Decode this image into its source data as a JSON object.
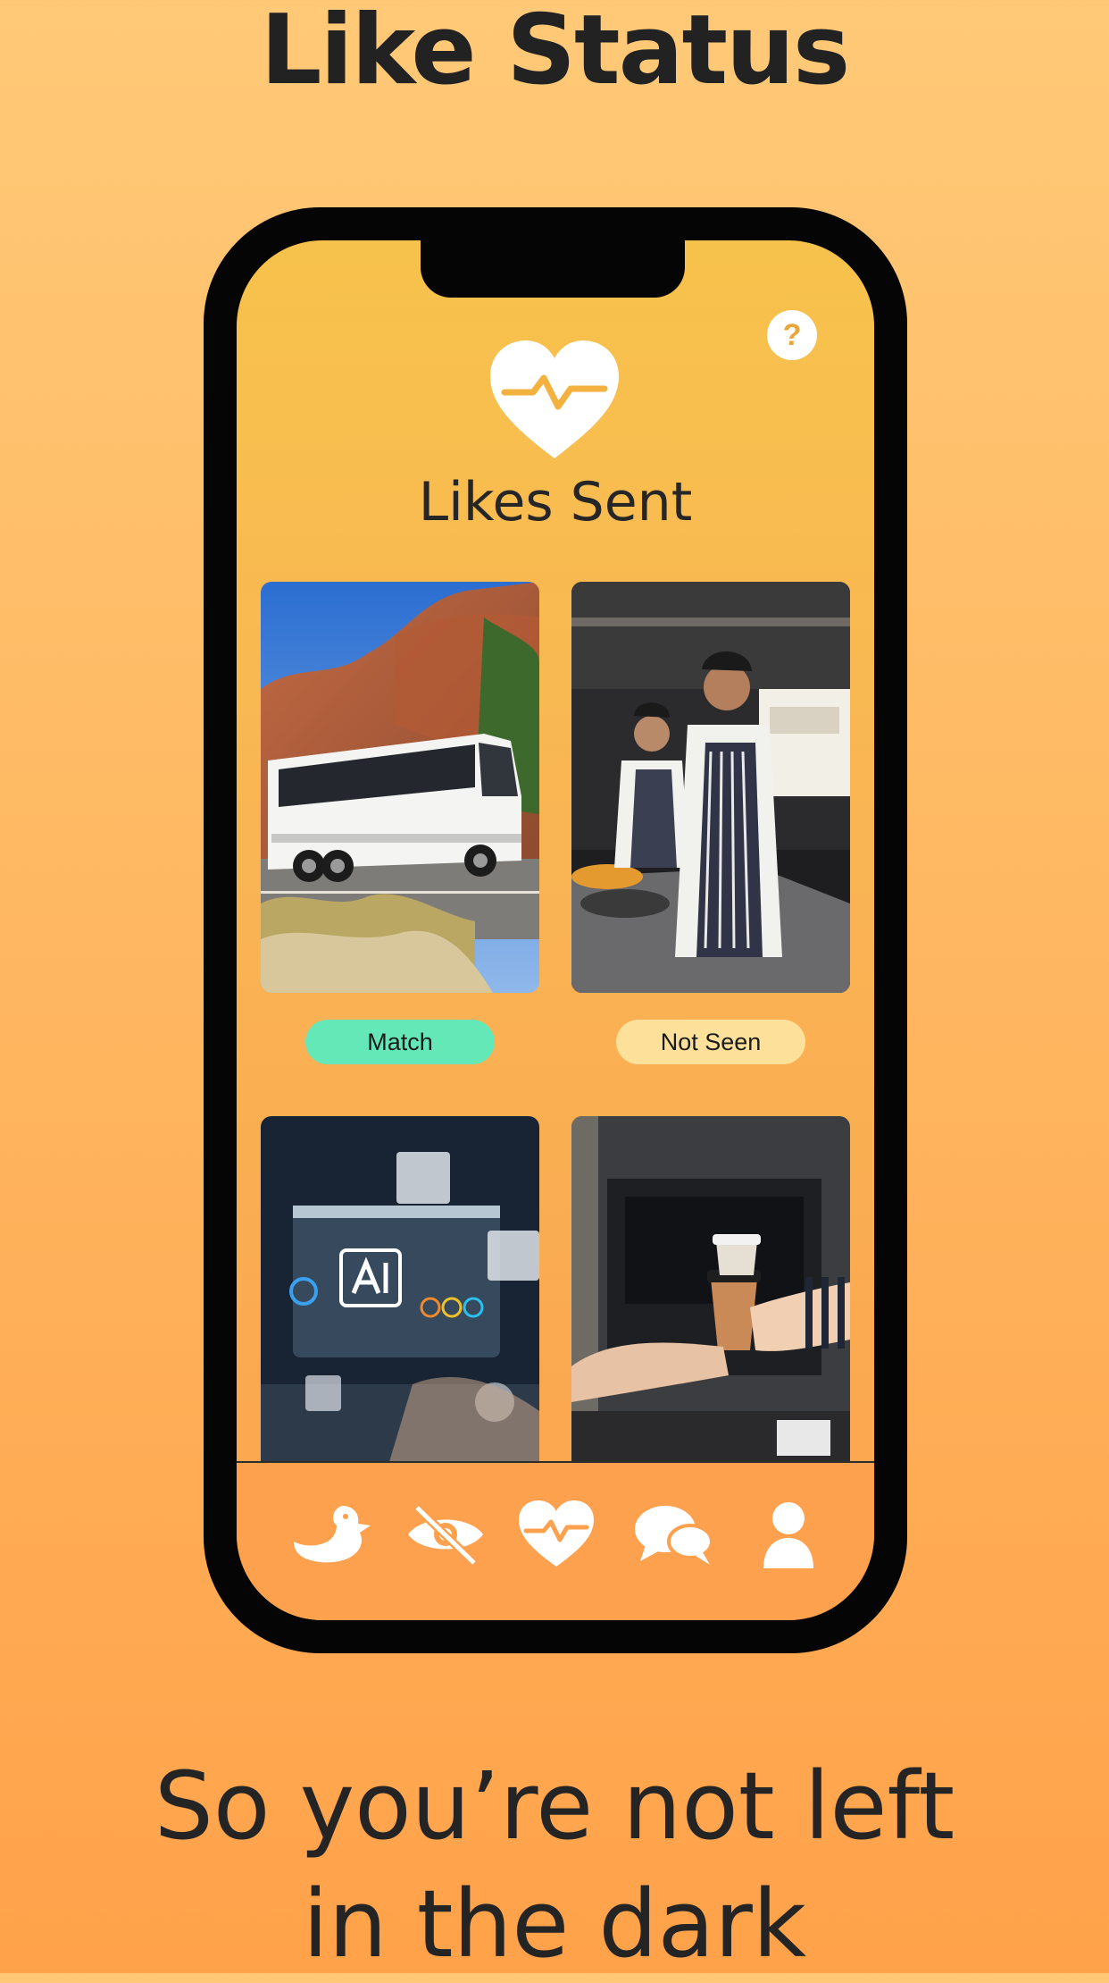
{
  "headline": "Like Status",
  "tagline": [
    "So you’re not left",
    "in the dark"
  ],
  "screen": {
    "title": "Likes Sent",
    "help_label": "?",
    "cards": [
      {
        "photo": "tour-bus-canyon",
        "status": "Match",
        "status_color": "#64e8b8"
      },
      {
        "photo": "chefs-in-kitchen",
        "status": "Not Seen",
        "status_color": "#fde09a"
      },
      {
        "photo": "ai-laptop-dashboard"
      },
      {
        "photo": "coffee-handoff"
      }
    ],
    "nav": [
      {
        "name": "duck-icon"
      },
      {
        "name": "eye-slash-icon"
      },
      {
        "name": "heart-pulse-icon",
        "active": true
      },
      {
        "name": "chat-bubbles-icon"
      },
      {
        "name": "user-icon"
      }
    ]
  },
  "colors": {
    "background_top": "#ffc977",
    "background_bottom": "#ffa24a",
    "screen_top": "#f7c24c",
    "match": "#64e8b8",
    "not_seen": "#fde09a"
  }
}
